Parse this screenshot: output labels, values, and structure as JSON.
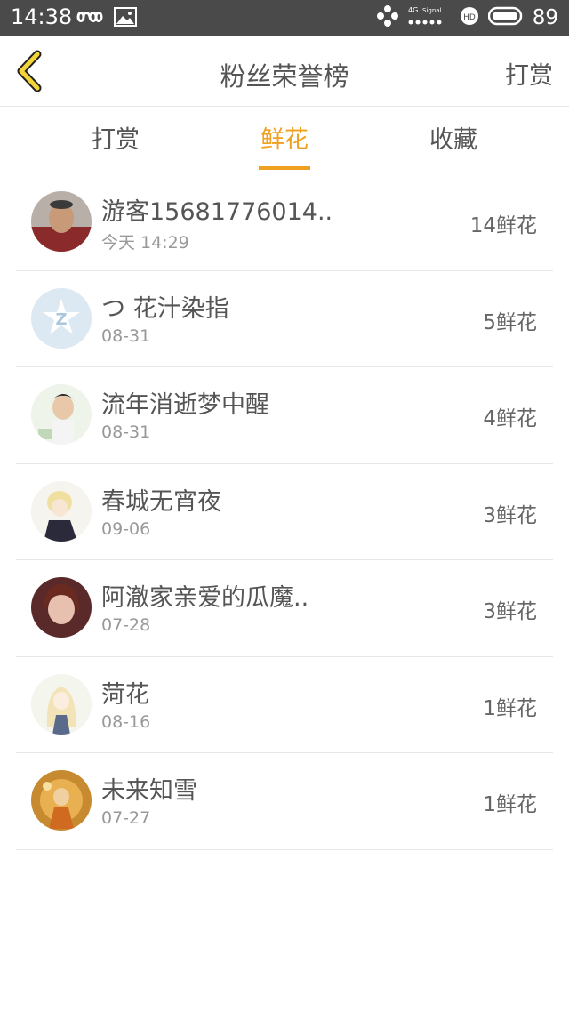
{
  "status_bar": {
    "time": "14:38",
    "battery": "89",
    "network_label": "4G",
    "signal_label": "Signal",
    "hd_label": "HD",
    "icons": [
      "infinity-icon",
      "image-icon",
      "dots-icon",
      "signal-icon",
      "hd-icon",
      "battery-icon"
    ]
  },
  "header": {
    "title": "粉丝荣誉榜",
    "right_action": "打赏",
    "back_icon": "chevron-left-icon"
  },
  "tabs": [
    {
      "label": "打赏",
      "active": false
    },
    {
      "label": "鲜花",
      "active": true
    },
    {
      "label": "收藏",
      "active": false
    }
  ],
  "fans": [
    {
      "name": "游客15681776014..",
      "date": "今天 14:29",
      "count": "14鲜花"
    },
    {
      "name": "つ 花汁染指",
      "date": "08-31",
      "count": "5鲜花"
    },
    {
      "name": "流年消逝梦中醒",
      "date": "08-31",
      "count": "4鲜花"
    },
    {
      "name": "春城无宵夜",
      "date": "09-06",
      "count": "3鲜花"
    },
    {
      "name": "阿澈家亲爱的瓜魔..",
      "date": "07-28",
      "count": "3鲜花"
    },
    {
      "name": "菏花",
      "date": "08-16",
      "count": "1鲜花"
    },
    {
      "name": "未来知雪",
      "date": "07-27",
      "count": "1鲜花"
    }
  ],
  "colors": {
    "accent": "#f0a020",
    "status_bar": "#4a4a4a",
    "divider": "#e6e6e6"
  }
}
